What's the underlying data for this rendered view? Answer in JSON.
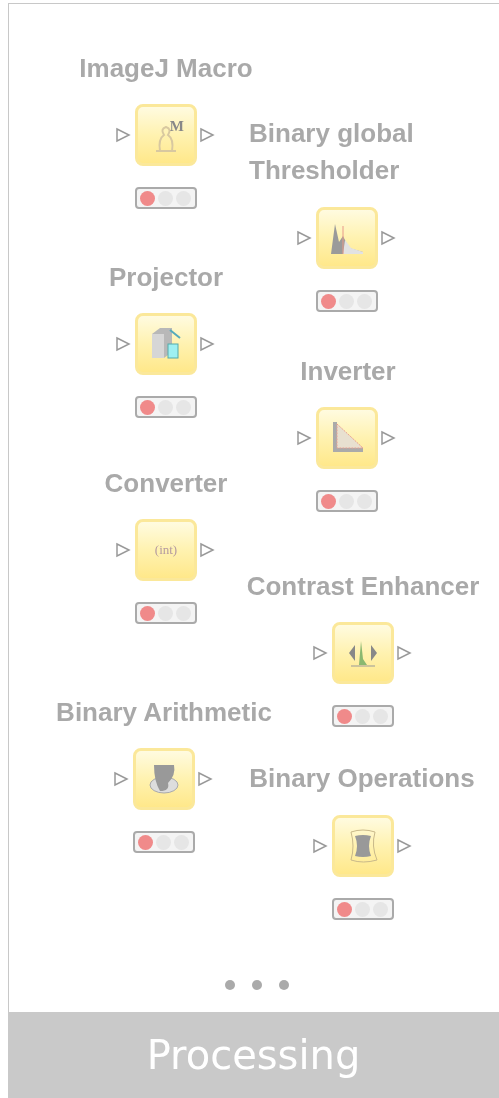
{
  "nodes": [
    {
      "label": "ImageJ Macro",
      "kind": "macro",
      "icon_text": "M",
      "configured": false
    },
    {
      "label": "Binary global\nThresholder",
      "kind": "histogram",
      "configured": false
    },
    {
      "label": "Projector",
      "kind": "projector",
      "configured": false
    },
    {
      "label": "Inverter",
      "kind": "inverter",
      "configured": false
    },
    {
      "label": "Converter",
      "kind": "converter",
      "icon_text": "(int)",
      "configured": false
    },
    {
      "label": "Contrast Enhancer",
      "kind": "contrast",
      "configured": false
    },
    {
      "label": "Binary Arithmetic",
      "kind": "arithmetic",
      "configured": false
    },
    {
      "label": "Binary Operations",
      "kind": "operations",
      "configured": false
    }
  ],
  "footer": {
    "title": "Processing"
  }
}
